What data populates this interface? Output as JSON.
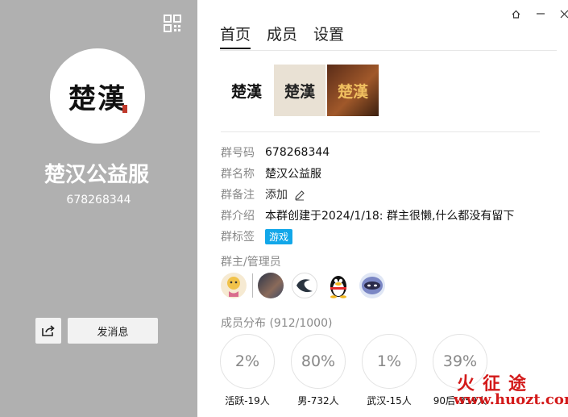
{
  "left": {
    "avatar_text": "楚漢",
    "group_name": "楚汉公益服",
    "group_id": "678268344",
    "send_message": "发消息"
  },
  "tabs": [
    {
      "label": "首页",
      "active": true
    },
    {
      "label": "成员",
      "active": false
    },
    {
      "label": "设置",
      "active": false
    }
  ],
  "photos": [
    "楚漢",
    "楚漢",
    "楚漢"
  ],
  "info": {
    "number": {
      "label": "群号码",
      "value": "678268344"
    },
    "name": {
      "label": "群名称",
      "value": "楚汉公益服"
    },
    "remark": {
      "label": "群备注",
      "value": "添加"
    },
    "intro": {
      "label": "群介绍",
      "value": "本群创建于2024/1/18:  群主很懒,什么都没有留下"
    },
    "tag": {
      "label": "群标签",
      "value": "游戏"
    }
  },
  "admins_label": "群主/管理员",
  "distribution_label": "成员分布 (912/1000)",
  "stats": [
    {
      "percent": "2%",
      "label": "活跃-19人"
    },
    {
      "percent": "80%",
      "label": "男-732人"
    },
    {
      "percent": "1%",
      "label": "武汉-15人"
    },
    {
      "percent": "39%",
      "label": "90后-359人"
    }
  ],
  "watermark": {
    "cn": "火征途",
    "url": "www.huozt.com"
  },
  "colors": {
    "left_bg": "#b0b0b0",
    "tag_blue": "#12a7e9",
    "watermark_red": "#d31a1a"
  }
}
